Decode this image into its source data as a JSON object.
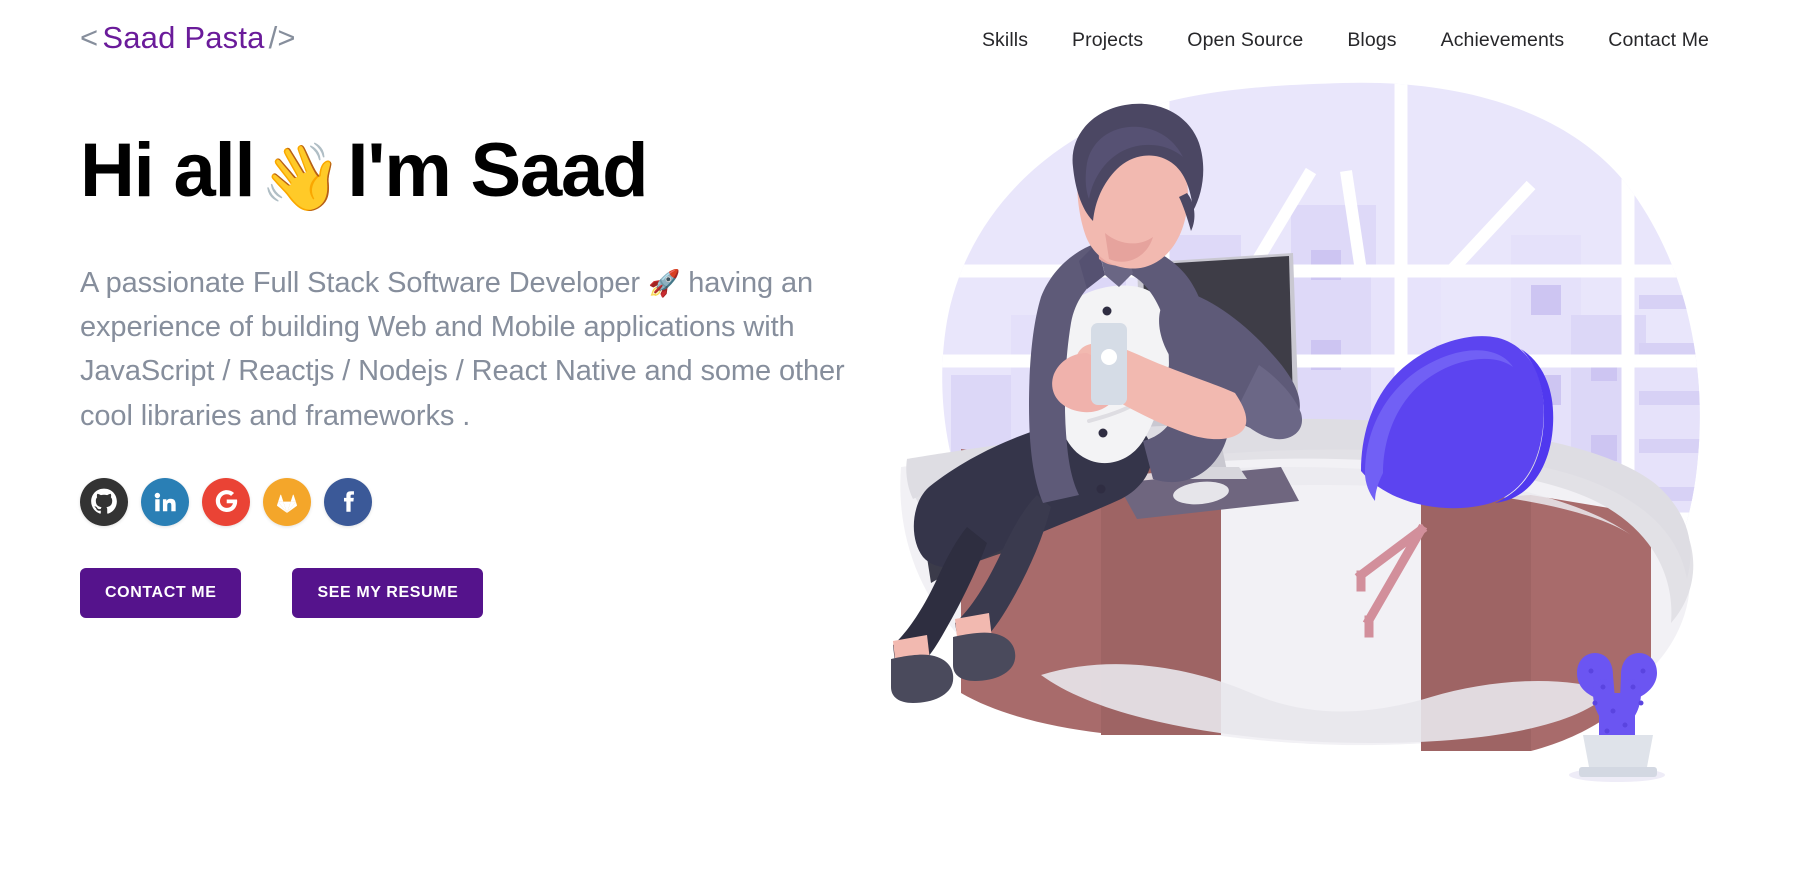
{
  "brand": {
    "open_bracket": "<",
    "name": "Saad Pasta",
    "close_bracket": "/>"
  },
  "nav": {
    "items": [
      {
        "label": "Skills"
      },
      {
        "label": "Projects"
      },
      {
        "label": "Open Source"
      },
      {
        "label": "Blogs"
      },
      {
        "label": "Achievements"
      },
      {
        "label": "Contact Me"
      }
    ]
  },
  "hero": {
    "headline_before": "Hi all",
    "headline_emoji": "👋",
    "headline_after": "I'm Saad",
    "subtitle_part1": "A passionate Full Stack Software Developer",
    "subtitle_emoji": "🚀",
    "subtitle_part2": "having an experience of building Web and Mobile applications with JavaScript / Reactjs / Nodejs / React Native and some other cool libraries and frameworks ."
  },
  "socials": [
    {
      "name": "github",
      "label": "GitHub",
      "bg": "#333333"
    },
    {
      "name": "linkedin",
      "label": "LinkedIn",
      "bg": "#2a7fb5"
    },
    {
      "name": "google",
      "label": "Google",
      "bg": "#ea4335"
    },
    {
      "name": "gitlab",
      "label": "GitLab",
      "bg": "#f4a62a"
    },
    {
      "name": "facebook",
      "label": "Facebook",
      "bg": "#3b5998"
    }
  ],
  "buttons": {
    "contact": "CONTACT ME",
    "resume": "SEE MY RESUME"
  },
  "colors": {
    "brand_purple": "#6a1b9a",
    "button_purple": "#55138c",
    "body_text_gray": "#868e9c",
    "nav_text": "#27272a",
    "illustration_lavender": "#e6e2fb",
    "illustration_chair": "#5c44f0",
    "illustration_desk": "#dedde3",
    "illustration_wood": "#ab6a6a"
  },
  "illustration": {
    "alt": "Illustration of a developer sitting on a desk with an iMac, office chair and potted cactus"
  }
}
